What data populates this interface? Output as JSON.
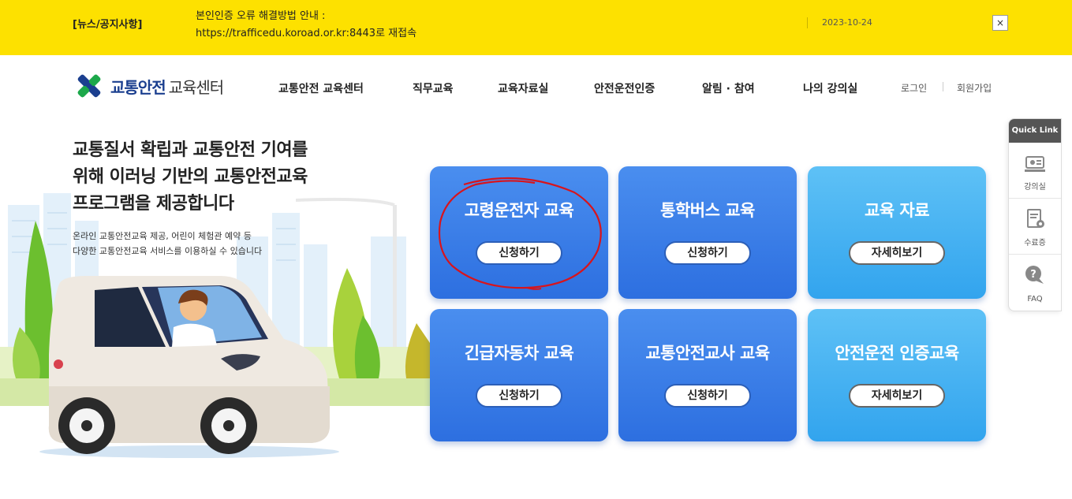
{
  "notice": {
    "category": "[뉴스/공지사항]",
    "line1": "본인인증 오류 해결방법 안내 :",
    "line2": "https://trafficedu.koroad.or.kr:8443로 재접속",
    "date": "2023-10-24",
    "close_label": "×"
  },
  "header": {
    "logo_strong": "교통안전",
    "logo_text": "교육센터",
    "nav": [
      "교통안전 교육센터",
      "직무교육",
      "교육자료실",
      "안전운전인증",
      "알림 · 참여",
      "나의 강의실"
    ],
    "login": "로그인",
    "signup": "회원가입"
  },
  "hero": {
    "title_lines": [
      "교통질서 확립과 교통안전 기여를",
      "위해 이러닝 기반의 교통안전교육",
      "프로그램을 제공합니다"
    ],
    "sub_lines": [
      "온라인 교통안전교육 제공, 어린이 체험관 예약 등",
      "다양한 교통안전교육 서비스를 이용하실 수 있습니다"
    ]
  },
  "cards": [
    {
      "title": "고령운전자 교육",
      "button": "신청하기",
      "style": "blue"
    },
    {
      "title": "통학버스 교육",
      "button": "신청하기",
      "style": "blue"
    },
    {
      "title": "교육 자료",
      "button": "자세히보기",
      "style": "cyan"
    },
    {
      "title": "긴급자동차 교육",
      "button": "신청하기",
      "style": "blue"
    },
    {
      "title": "교통안전교사 교육",
      "button": "신청하기",
      "style": "blue"
    },
    {
      "title": "안전운전 인증교육",
      "button": "자세히보기",
      "style": "cyan"
    }
  ],
  "quick_link": {
    "title": "Quick Link",
    "items": [
      {
        "label": "강의실",
        "icon": "classroom-icon"
      },
      {
        "label": "수료증",
        "icon": "certificate-icon"
      },
      {
        "label": "FAQ",
        "icon": "faq-icon"
      }
    ]
  },
  "colors": {
    "notice_bg": "#fde100",
    "card_blue": "#2d6fe0",
    "card_cyan": "#32a4ee",
    "annotation": "#d8141c"
  }
}
